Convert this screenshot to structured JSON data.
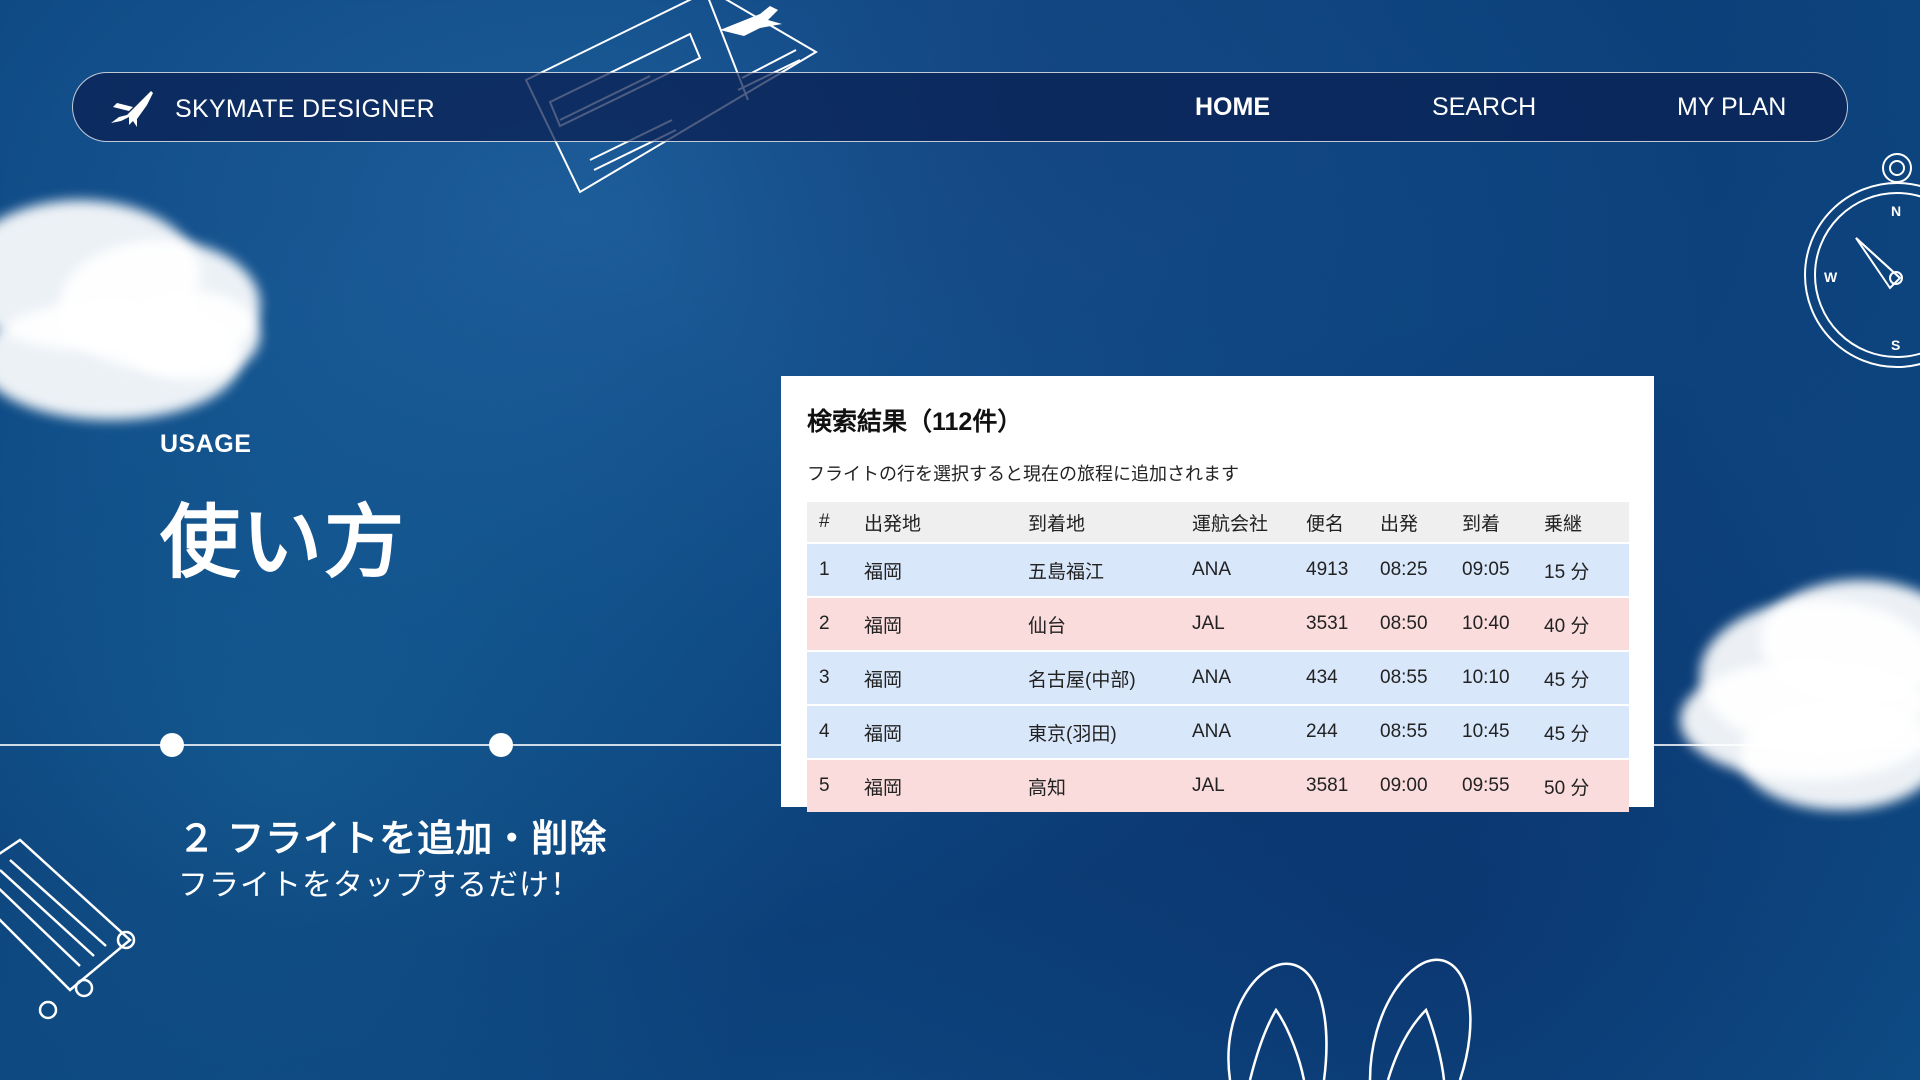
{
  "nav": {
    "brand": "SKYMATE DESIGNER",
    "brand_icon": "airplane-icon",
    "links": [
      {
        "label": "HOME",
        "active": true
      },
      {
        "label": "SEARCH",
        "active": false
      },
      {
        "label": "MY PLAN",
        "active": false
      }
    ]
  },
  "section": {
    "label": "USAGE",
    "title": "使い方"
  },
  "step": {
    "title": "２ フライトを追加・削除",
    "description": "フライトをタップするだけ！"
  },
  "results": {
    "title": "検索結果（112件）",
    "subtitle": "フライトの行を選択すると現在の旅程に追加されます",
    "columns": [
      "#",
      "出発地",
      "到着地",
      "運航会社",
      "便名",
      "出発",
      "到着",
      "乗継"
    ],
    "rows": [
      {
        "no": "1",
        "from": "福岡",
        "to": "五島福江",
        "carrier": "ANA",
        "flight": "4913",
        "dep": "08:25",
        "arr": "09:05",
        "transfer": "15 分"
      },
      {
        "no": "2",
        "from": "福岡",
        "to": "仙台",
        "carrier": "JAL",
        "flight": "3531",
        "dep": "08:50",
        "arr": "10:40",
        "transfer": "40 分"
      },
      {
        "no": "3",
        "from": "福岡",
        "to": "名古屋(中部)",
        "carrier": "ANA",
        "flight": "434",
        "dep": "08:55",
        "arr": "10:10",
        "transfer": "45 分"
      },
      {
        "no": "4",
        "from": "福岡",
        "to": "東京(羽田)",
        "carrier": "ANA",
        "flight": "244",
        "dep": "08:55",
        "arr": "10:45",
        "transfer": "45 分"
      },
      {
        "no": "5",
        "from": "福岡",
        "to": "高知",
        "carrier": "JAL",
        "flight": "3581",
        "dep": "09:00",
        "arr": "09:55",
        "transfer": "50 分"
      }
    ]
  },
  "colors": {
    "ana_row": "#d9e7fb",
    "jal_row": "#fbdcdc",
    "header_row": "#efefef",
    "background": "#0f4a85"
  },
  "decorations": [
    "boarding-pass-icon",
    "compass-icon",
    "suitcase-icon",
    "flip-flops-icon",
    "cloud-left",
    "cloud-right"
  ]
}
